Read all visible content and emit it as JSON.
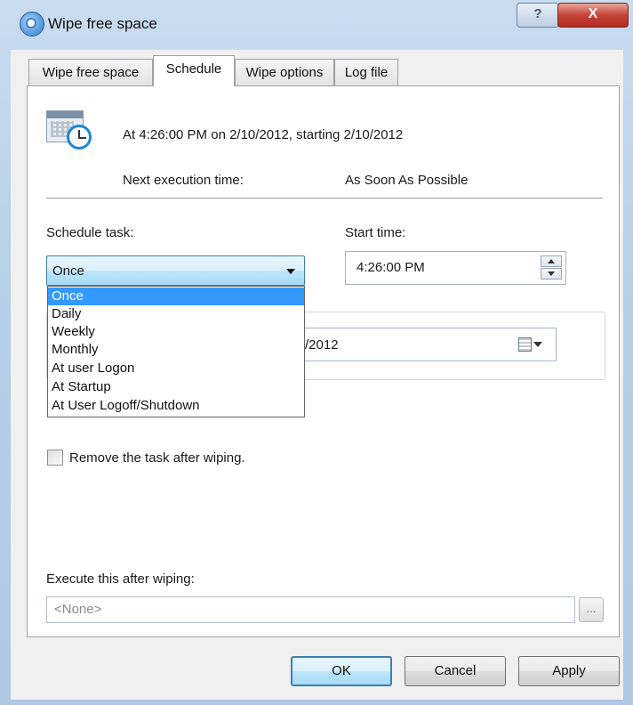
{
  "window": {
    "title": "Wipe free space",
    "help_glyph": "?",
    "close_glyph": "X"
  },
  "tabs": [
    {
      "label": "Wipe free space",
      "active": false
    },
    {
      "label": "Schedule",
      "active": true
    },
    {
      "label": "Wipe options",
      "active": false
    },
    {
      "label": "Log file",
      "active": false
    }
  ],
  "schedule": {
    "summary": "At 4:26:00 PM on 2/10/2012, starting 2/10/2012",
    "next_execution_label": "Next execution time:",
    "next_execution_value": "As Soon As Possible",
    "schedule_task_label": "Schedule task:",
    "schedule_task_selected": "Once",
    "schedule_task_options": [
      "Once",
      "Daily",
      "Weekly",
      "Monthly",
      "At user Logon",
      "At Startup",
      "At User Logoff/Shutdown"
    ],
    "start_time_label": "Start time:",
    "start_time_value": "4:26:00 PM",
    "start_date_partial": "/2012",
    "remove_task_label": "Remove the task after wiping.",
    "remove_task_checked": false,
    "execute_after_label": "Execute this after wiping:",
    "execute_after_placeholder": "<None>",
    "browse_label": "..."
  },
  "buttons": {
    "ok": "OK",
    "cancel": "Cancel",
    "apply": "Apply"
  },
  "icons": {
    "app": "wipe-app-icon",
    "calendar": "calendar-clock-icon"
  },
  "colors": {
    "selection": "#3399ff",
    "accent_border": "#3c7fb1"
  }
}
